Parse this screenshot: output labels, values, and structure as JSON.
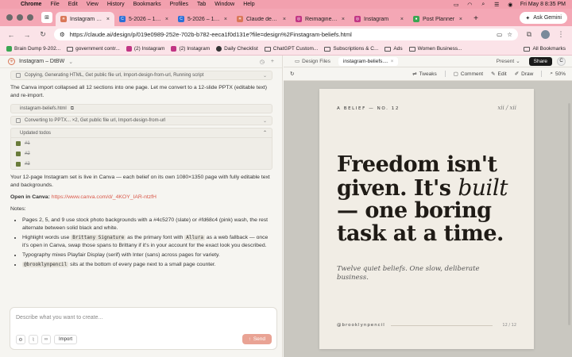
{
  "menubar": {
    "app": "Chrome",
    "items": [
      "File",
      "Edit",
      "View",
      "History",
      "Bookmarks",
      "Profiles",
      "Tab",
      "Window",
      "Help"
    ],
    "datetime": "Fri May 8  8:35 PM"
  },
  "tabs": [
    {
      "title": "Instagram – DtBW",
      "active": true,
      "color": "#d97757"
    },
    {
      "title": "5-2026 – 12 Beli",
      "active": false,
      "color": "#2b6fd6"
    },
    {
      "title": "5-2026 – 12 Beli",
      "active": false,
      "color": "#2b6fd6"
    },
    {
      "title": "Claude design",
      "active": false,
      "color": "#d97757"
    },
    {
      "title": "Reimagine Your",
      "active": false,
      "color": "#c13584"
    },
    {
      "title": "Instagram",
      "active": false,
      "color": "#c13584"
    },
    {
      "title": "Post Planner",
      "active": false,
      "color": "#3aa652"
    }
  ],
  "ask_gemini": "Ask Gemini",
  "address": {
    "url": "https://claude.ai/design/p/019e0989-252e-702b-b782-eeca1f0d131e?file=design%2Finstagram-beliefs.html"
  },
  "bookmarks": [
    {
      "label": "Brain Dump 9-202...",
      "color": "#3aa652"
    },
    {
      "label": "government contr...",
      "color": ""
    },
    {
      "label": "(2) Instagram",
      "color": "#c13584"
    },
    {
      "label": "(2) Instagram",
      "color": "#c13584"
    },
    {
      "label": "Daily Checklist",
      "color": "#333333"
    },
    {
      "label": "ChatGPT Custom...",
      "color": ""
    },
    {
      "label": "Subscriptions & C...",
      "color": ""
    },
    {
      "label": "Ads",
      "color": ""
    },
    {
      "label": "Women Business...",
      "color": ""
    }
  ],
  "bookmarks_all": "All Bookmarks",
  "chat": {
    "project_title": "Instagram – DtBW",
    "tool_line_1": "Copying, Generating HTML, Get public file url, Import-design-from-url, Running script",
    "para_1": "The Canva import collapsed all 12 sections into one page. Let me convert to a 12-slide PPTX (editable text) and re-import.",
    "file_card": "instagram-beliefs.html",
    "tool_line_2": "Converting to PPTX... ×2, Get public file url, Import-design-from-url",
    "todos_title": "Updated todos",
    "todos": [
      "#1",
      "#2",
      "#3"
    ],
    "para_2": "Your 12-page Instagram set is live in Canva — each belief on its own 1080×1350 page with fully editable text and backgrounds.",
    "open_label": "Open in Canva:",
    "open_link": "https://www.canva.com/d/_4KOY_IAR-ntzfH",
    "notes_label": "Notes:",
    "note_1": "Pages 2, 5, and 9 use stock photo backgrounds with a #4c5270 (slate) or #fd68c4 (pink) wash, the rest alternate between solid black and white.",
    "note_2_a": "Highlight words use",
    "note_2_code1": "Brittany Signature",
    "note_2_b": "as the primary font with",
    "note_2_code2": "Allura",
    "note_2_c": "as a web fallback — once it's open in Canva, swap those spans to Brittany if it's in your account for the exact look you described.",
    "note_3": "Typography mixes Playfair Display (serif) with Inter (sans) across pages for variety.",
    "note_4_code": "@brooklynpencil",
    "note_4_text": "sits at the bottom of every page next to a small page counter.",
    "composer_placeholder": "Describe what you want to create...",
    "import_label": "Import",
    "send_label": "Send"
  },
  "design": {
    "tab_files": "Design Files",
    "tab_active": "instagram-beliefs....",
    "present_label": "Present",
    "share_label": "Share",
    "user_initial": "C",
    "toolbar": {
      "tweaks": "Tweaks",
      "comment": "Comment",
      "edit": "Edit",
      "draw": "Draw",
      "zoom": "50%"
    },
    "card": {
      "eyebrow": "A BELIEF — NO. 12",
      "page": "xii / xii",
      "headline_1": "Freedom isn't",
      "headline_2": "given. It's",
      "headline_script": "built",
      "headline_3": "— one boring",
      "headline_4": "task at a time.",
      "subtitle": "Twelve quiet beliefs. One slow, deliberate business.",
      "handle": "@brooklynpencil",
      "count": "12 / 12"
    }
  }
}
